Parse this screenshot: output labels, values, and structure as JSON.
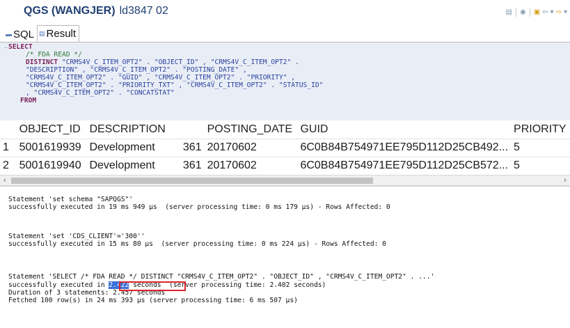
{
  "window": {
    "system": "QGS (WANGJER)",
    "connection": "ld3847 02"
  },
  "toolbar_icons": [
    "db-icon",
    "connect-icon",
    "stop-icon",
    "back-icon",
    "menu-arrow-icon",
    "forward-icon",
    "menu-arrow-icon"
  ],
  "tabs": [
    {
      "label": "SQL",
      "icon": "sql-icon",
      "active": false
    },
    {
      "label": "Result",
      "icon": "result-icon",
      "active": true
    }
  ],
  "sql": {
    "select_kw": "SELECT",
    "comment": "/* FDA READ */",
    "distinct_kw": "DISTINCT",
    "line1": " \"CRMS4V_C_ITEM_OPT2\" . \"OBJECT_ID\" , \"CRMS4V_C_ITEM_OPT2\" .",
    "line2": "\"DESCRIPTION\" , \"CRMS4V_C_ITEM_OPT2\" . \"POSTING_DATE\" ,",
    "line3": "\"CRMS4V_C_ITEM_OPT2\" . \"GUID\" , \"CRMS4V_C_ITEM_OPT2\" . \"PRIORITY\" ,",
    "line4": "\"CRMS4V_C_ITEM_OPT2\" . \"PRIORITY_TXT\" , \"CRMS4V_C_ITEM_OPT2\" . \"STATUS_ID\"",
    "line5": ", \"CRMS4V_C_ITEM_OPT2\" . \"CONCATSTAT\"",
    "from_kw": "FROM"
  },
  "results": {
    "columns": [
      "",
      "OBJECT_ID",
      "DESCRIPTION",
      "",
      "POSTING_DATE",
      "GUID",
      "PRIORITY"
    ],
    "rows": [
      [
        "1",
        "5001619939",
        "Development",
        "361",
        "20170602",
        "6C0B84B754971EE795D112D25CB492...",
        "5"
      ],
      [
        "2",
        "5001619940",
        "Development",
        "361",
        "20170602",
        "6C0B84B754971EE795D112D25CB572...",
        "5"
      ]
    ]
  },
  "console": {
    "s1_stmt": "Statement 'set schema \"SAPQGS\"'",
    "s1_result": "successfully executed in 19 ms 949 µs  (server processing time: 0 ms 179 µs) - Rows Affected: 0",
    "s2_stmt": "Statement 'set 'CDS_CLIENT'='300''",
    "s2_result": "successfully executed in 15 ms 80 µs  (server processing time: 0 ms 224 µs) - Rows Affected: 0",
    "s3_stmt": "Statement 'SELECT /* FDA READ */ DISTINCT \"CRMS4V_C_ITEM_OPT2\" . \"OBJECT_ID\" , \"CRMS4V_C_ITEM_OPT2\" . ...'",
    "s3_prefix": "successfully executed in ",
    "s3_hl_num": "2.422",
    "s3_hl_unit": " seconds",
    "s3_suffix": "  (server processing time: 2.402 seconds)",
    "duration": "Duration of 3 statements: 2.457 seconds",
    "fetched": "Fetched 100 row(s) in 24 ms 393 µs (server processing time: 6 ms 507 µs)"
  },
  "colors": {
    "title": "#1f3f73",
    "sql_background": "#e9eef6",
    "keyword": "#7a1f5c",
    "comment": "#2f7a3a",
    "identifier": "#2a3f9e",
    "highlight": "#3a6fd8",
    "annotation_box": "#d9262b"
  }
}
